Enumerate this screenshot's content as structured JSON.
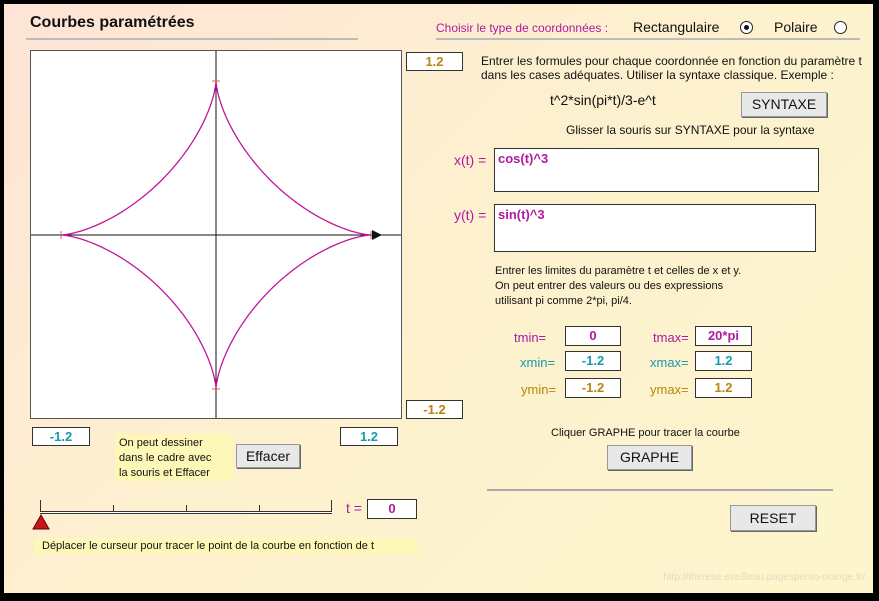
{
  "title": "Courbes paramétrées",
  "coordinates": {
    "label": "Choisir le type de coordonnées :",
    "rect_label": "Rectangulaire",
    "polar_label": "Polaire",
    "selected": "Rectangulaire"
  },
  "graph": {
    "ymax_display": "1.2",
    "ymin_display": "-1.2",
    "xmin_display": "-1.2",
    "xmax_display": "1.2",
    "curve_color": "#c0179b"
  },
  "draw_note": {
    "lines": [
      "On   peut   dessiner",
      "dans le cadre avec",
      "la souris et  Effacer"
    ]
  },
  "erase_button": "Effacer",
  "slider": {
    "t_label": "t =",
    "t_value": "0",
    "position": 0,
    "help": "Déplacer le curseur pour tracer le point de la courbe en fonction de t"
  },
  "instructions": {
    "line1": "Entrer les formules pour chaque coordonnée en fonction du paramètre t",
    "line2": "dans les cases adéquates. Utiliser la syntaxe classique. Exemple :",
    "example": "t^2*sin(pi*t)/3-e^t",
    "syntax_button": "SYNTAXE",
    "syntax_hint": "Glisser la souris sur SYNTAXE pour la syntaxe"
  },
  "formulas": {
    "x_label": "x(t) =",
    "x_value": "cos(t)^3",
    "y_label": "y(t) =",
    "y_value": "sin(t)^3"
  },
  "limits_text": {
    "line1": "Entrer les limites  du paramètre t et celles de  x et  y.",
    "line2": "On peut entrer des valeurs ou des expressions",
    "line3": "utilisant pi comme  2*pi, pi/4."
  },
  "limits": {
    "tmin_label": "tmin=",
    "tmin": "0",
    "tmax_label": "tmax=",
    "tmax": "20*pi",
    "xmin_label": "xmin=",
    "xmin": "-1.2",
    "xmax_label": "xmax=",
    "xmax": "1.2",
    "ymin_label": "ymin=",
    "ymin": "-1.2",
    "ymax_label": "ymax=",
    "ymax": "1.2"
  },
  "graph_hint": "Cliquer GRAPHE pour tracer la courbe",
  "graph_button": "GRAPHE",
  "reset_button": "RESET",
  "footer": "http://therese.eveilleau.pagesperso-orange.fr/"
}
